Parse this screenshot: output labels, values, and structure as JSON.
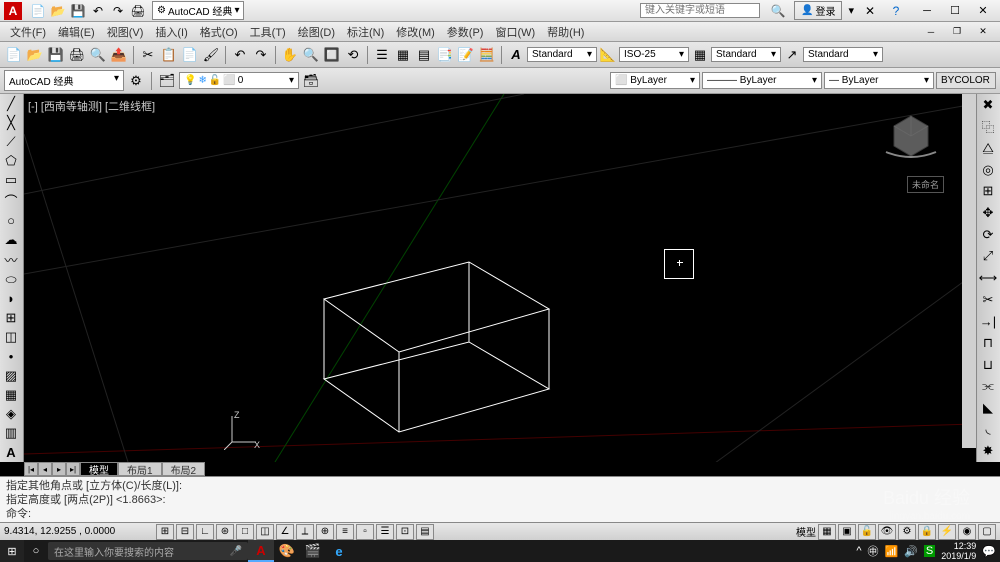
{
  "title_bar": {
    "workspace": "AutoCAD 经典",
    "search_placeholder": "键入关键字或短语",
    "login": "登录"
  },
  "menus": {
    "file": "文件(F)",
    "edit": "编辑(E)",
    "view": "视图(V)",
    "insert": "插入(I)",
    "format": "格式(O)",
    "tools": "工具(T)",
    "draw": "绘图(D)",
    "dimension": "标注(N)",
    "modify": "修改(M)",
    "parametric": "参数(P)",
    "window": "窗口(W)",
    "help": "帮助(H)"
  },
  "style_toolbar": {
    "text_style": "Standard",
    "dim_style": "ISO-25",
    "table_style": "Standard",
    "mleader_style": "Standard"
  },
  "layer_toolbar": {
    "workspace_current": "AutoCAD 经典",
    "layer_current": "0",
    "color": "ByLayer",
    "linetype": "ByLayer",
    "lineweight": "ByLayer",
    "plotstyle": "BYCOLOR"
  },
  "viewport": {
    "label": "[-] [西南等轴测] [二维线框]",
    "unnamed": "未命名"
  },
  "tabs": {
    "model": "模型",
    "layout1": "布局1",
    "layout2": "布局2"
  },
  "command": {
    "line1": "指定其他角点或 [立方体(C)/长度(L)]:",
    "line2": "指定高度或 [两点(2P)] <1.8663>:",
    "prompt": "命令:"
  },
  "status": {
    "coords": "9.4314,   12.9255 ,  0.0000",
    "model_label": "模型"
  },
  "taskbar": {
    "search_placeholder": "在这里输入你要搜索的内容",
    "time": "12:39",
    "date": "2019/1/9"
  },
  "watermark": {
    "main": "Baidu 经验",
    "sub": "jingyan.baidu.com"
  }
}
